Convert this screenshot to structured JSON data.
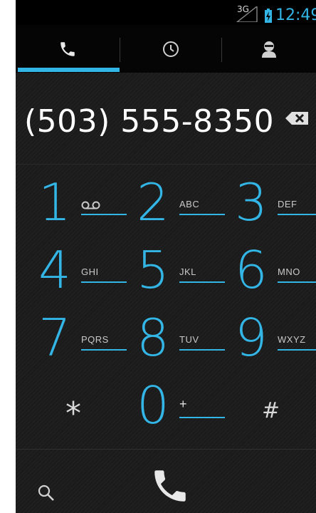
{
  "status_bar": {
    "network": "3G",
    "time": "12:49",
    "accent_color": "#33b5e5"
  },
  "tabs": [
    {
      "name": "dialer",
      "icon": "phone-icon",
      "selected": true
    },
    {
      "name": "call-log",
      "icon": "clock-icon",
      "selected": false
    },
    {
      "name": "contacts",
      "icon": "person-icon",
      "selected": false
    }
  ],
  "dialer": {
    "number": "(503) 555-8350"
  },
  "keypad": [
    {
      "digit": "1",
      "letters": "",
      "icon": "voicemail-icon"
    },
    {
      "digit": "2",
      "letters": "ABC"
    },
    {
      "digit": "3",
      "letters": "DEF"
    },
    {
      "digit": "4",
      "letters": "GHI"
    },
    {
      "digit": "5",
      "letters": "JKL"
    },
    {
      "digit": "6",
      "letters": "MNO"
    },
    {
      "digit": "7",
      "letters": "PQRS"
    },
    {
      "digit": "8",
      "letters": "TUV"
    },
    {
      "digit": "9",
      "letters": "WXYZ"
    },
    {
      "digit": "*",
      "letters": ""
    },
    {
      "digit": "0",
      "letters": "+"
    },
    {
      "digit": "#",
      "letters": ""
    }
  ],
  "bottom_bar": {
    "search_icon": "search-icon",
    "call_icon": "phone-icon"
  }
}
